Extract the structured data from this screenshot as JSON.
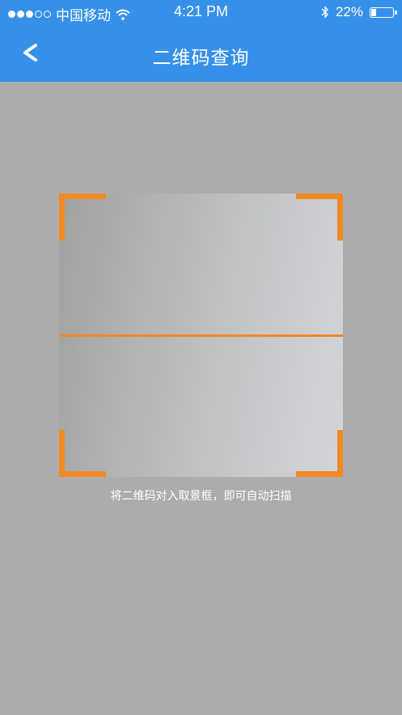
{
  "status_bar": {
    "carrier": "中国移动",
    "time": "4:21 PM",
    "battery_percent": "22%",
    "battery_level": 0.22,
    "signal_bars_filled": 3,
    "signal_bars_total": 5
  },
  "header": {
    "title": "二维码查询",
    "back_icon": "chevron-left-icon"
  },
  "scanner": {
    "hint": "将二维码对入取景框，即可自动扫描"
  },
  "colors": {
    "header_bg": "#3590ea",
    "accent": "#f08a24",
    "background": "#acacac"
  }
}
